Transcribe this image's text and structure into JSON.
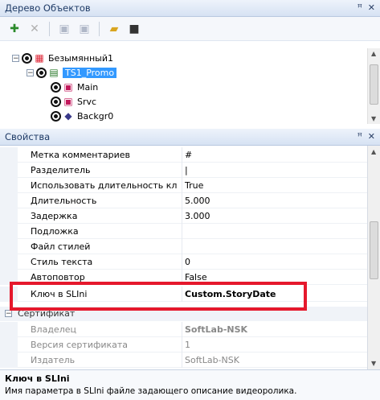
{
  "object_tree": {
    "title": "Дерево Объектов",
    "pin_icon": "pin-icon",
    "nodes": [
      {
        "label": "Безымянный1",
        "icon": "project-icon"
      },
      {
        "label": "TS1_Promo",
        "icon": "scene-icon",
        "selected": true
      },
      {
        "label": "Main",
        "icon": "layer-icon"
      },
      {
        "label": "Srvc",
        "icon": "layer-icon"
      },
      {
        "label": "Backgr0",
        "icon": "background-icon"
      }
    ]
  },
  "properties": {
    "title": "Свойства",
    "rows": [
      {
        "name": "Метка комментариев",
        "value": "#"
      },
      {
        "name": "Разделитель",
        "value": "|"
      },
      {
        "name": "Использовать длительность кл",
        "value": "True"
      },
      {
        "name": "Длительность",
        "value": "5.000"
      },
      {
        "name": "Задержка",
        "value": "3.000"
      },
      {
        "name": "Подложка",
        "value": ""
      },
      {
        "name": "Файл стилей",
        "value": ""
      },
      {
        "name": "Стиль текста",
        "value": "0"
      },
      {
        "name": "Автоповтор",
        "value": "False"
      },
      {
        "name": "Ключ в SLIni",
        "value": "Custom.StoryDate"
      }
    ],
    "category": "Сертификат",
    "cert_rows": [
      {
        "name": "Владелец",
        "value": "SoftLab-NSK"
      },
      {
        "name": "Версия сертификата",
        "value": "1"
      },
      {
        "name": "Издатель",
        "value": "SoftLab-NSK"
      }
    ]
  },
  "description": {
    "title": "Ключ в SLIni",
    "text": "Имя параметра в SLIni файле задающего описание видеоролика."
  },
  "colors": {
    "selection": "#3399ff",
    "highlight_frame": "#e5182c"
  }
}
